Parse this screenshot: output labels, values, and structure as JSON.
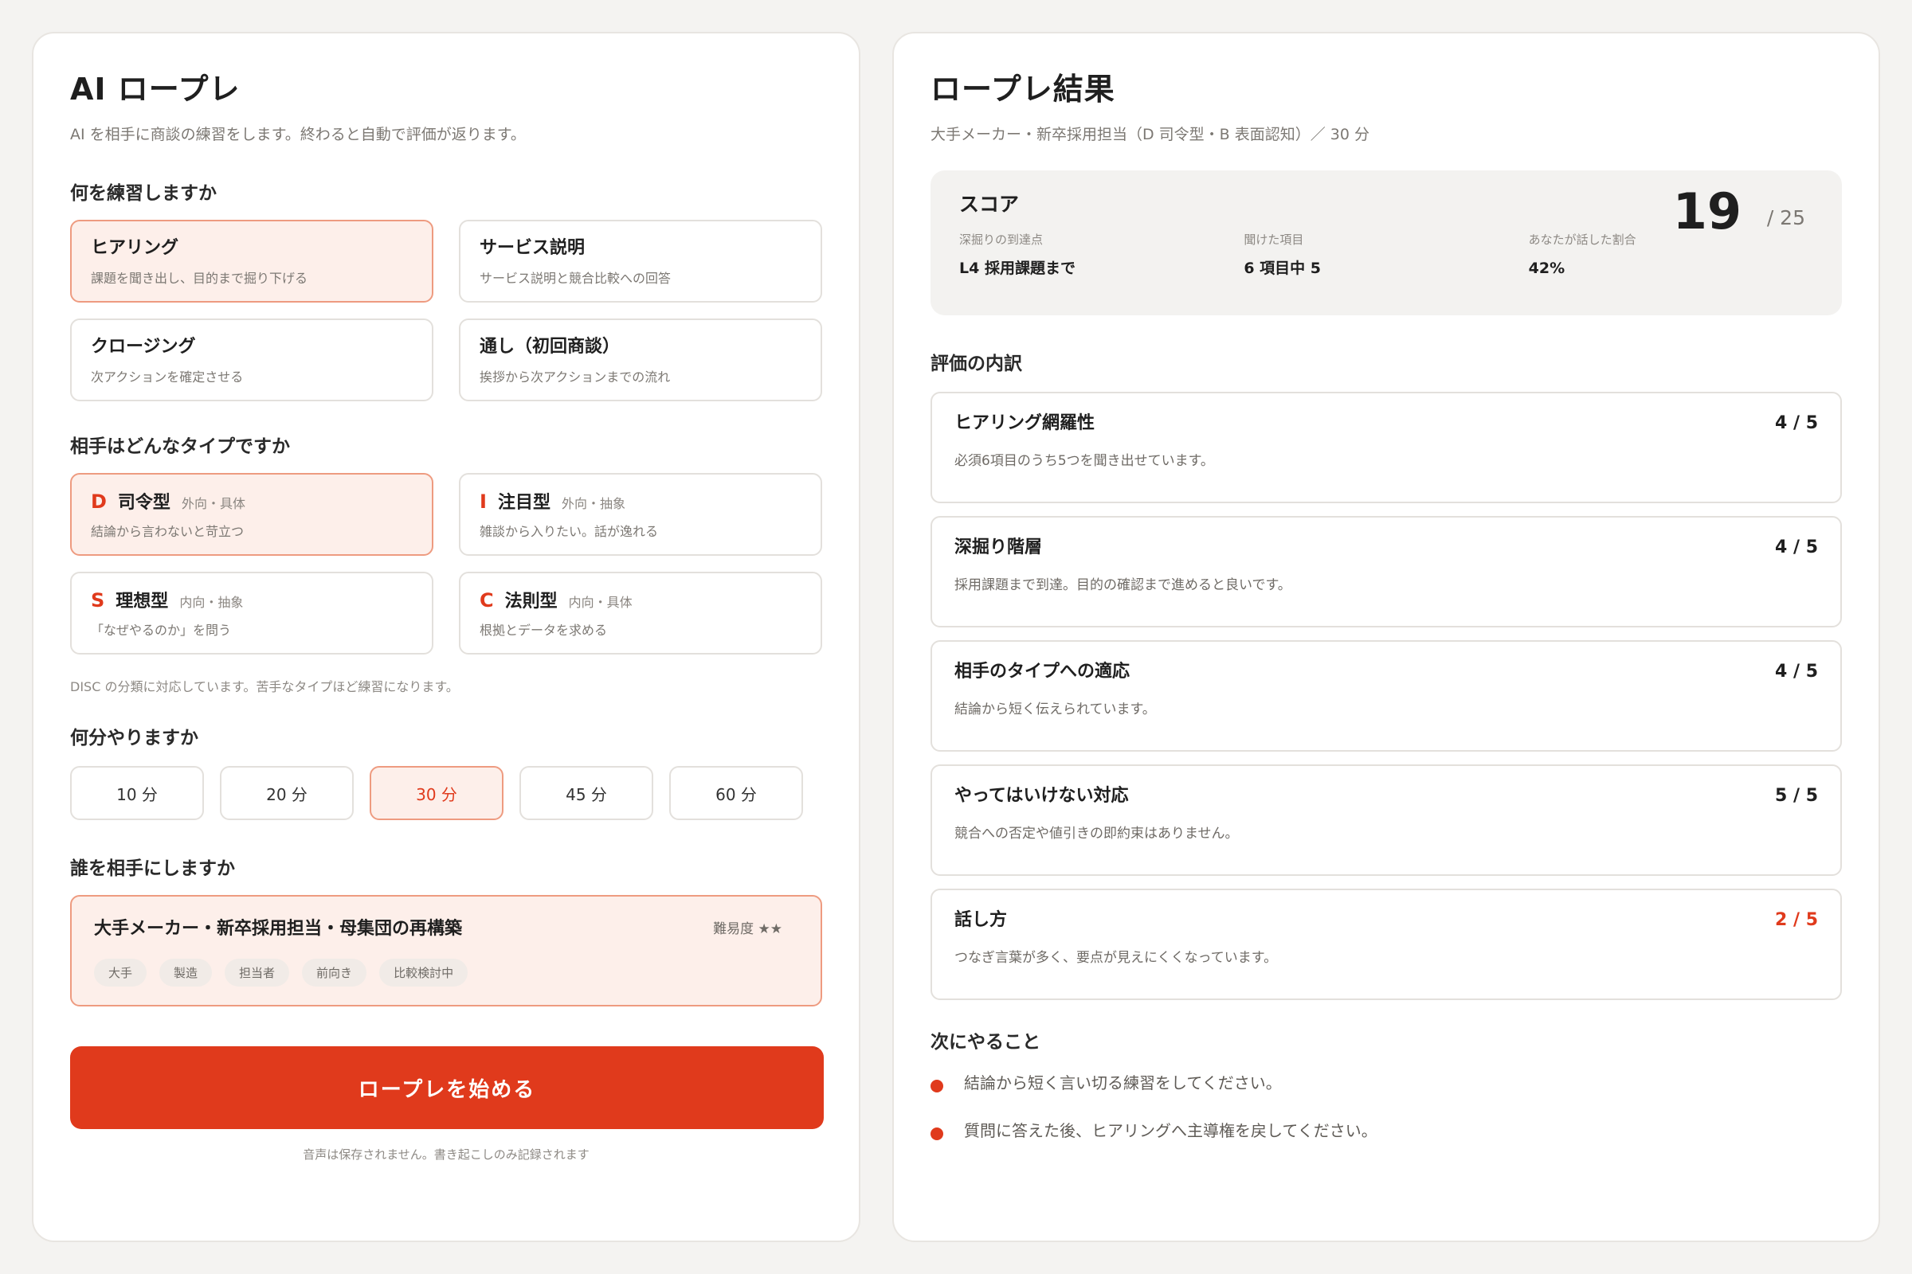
{
  "left": {
    "title": "AI ロープレ",
    "subtitle": "AI を相手に商談の練習をします。終わると自動で評価が返ります。",
    "practice": {
      "label": "何を練習しますか",
      "options": [
        {
          "title": "ヒアリング",
          "desc": "課題を聞き出し、目的まで掘り下げる",
          "selected": true
        },
        {
          "title": "サービス説明",
          "desc": "サービス説明と競合比較への回答",
          "selected": false
        },
        {
          "title": "クロージング",
          "desc": "次アクションを確定させる",
          "selected": false
        },
        {
          "title": "通し（初回商談）",
          "desc": "挨拶から次アクションまでの流れ",
          "selected": false
        }
      ]
    },
    "type": {
      "label": "相手はどんなタイプですか",
      "options": [
        {
          "letter": "D",
          "title": "司令型",
          "tag": "外向・具体",
          "desc": "結論から言わないと苛立つ",
          "selected": true
        },
        {
          "letter": "I",
          "title": "注目型",
          "tag": "外向・抽象",
          "desc": "雑談から入りたい。話が逸れる",
          "selected": false
        },
        {
          "letter": "S",
          "title": "理想型",
          "tag": "内向・抽象",
          "desc": "「なぜやるのか」を問う",
          "selected": false
        },
        {
          "letter": "C",
          "title": "法則型",
          "tag": "内向・具体",
          "desc": "根拠とデータを求める",
          "selected": false
        }
      ],
      "note": "DISC の分類に対応しています。苦手なタイプほど練習になります。"
    },
    "duration": {
      "label": "何分やりますか",
      "options": [
        "10 分",
        "20 分",
        "30 分",
        "45 分",
        "60 分"
      ],
      "selected": "30 分"
    },
    "scenario": {
      "label": "誰を相手にしますか",
      "title": "大手メーカー・新卒採用担当・母集団の再構築",
      "difficulty": "難易度 ★★",
      "tags": [
        "大手",
        "製造",
        "担当者",
        "前向き",
        "比較検討中"
      ]
    },
    "start_label": "ロープレを始める",
    "footer_note": "音声は保存されません。書き起こしのみ記録されます"
  },
  "right": {
    "title": "ロープレ結果",
    "subtitle": "大手メーカー・新卒採用担当（D 司令型・B 表面認知）／ 30 分",
    "score": {
      "label": "スコア",
      "value": "19",
      "max": "/ 25",
      "stats": [
        {
          "label": "深掘りの到達点",
          "value": "L4 採用課題まで"
        },
        {
          "label": "聞けた項目",
          "value": "6 項目中 5"
        },
        {
          "label": "あなたが話した割合",
          "value": "42%"
        }
      ]
    },
    "breakdown": {
      "label": "評価の内訳",
      "items": [
        {
          "name": "ヒアリング網羅性",
          "score": "4 / 5",
          "comment": "必須6項目のうち5つを聞き出せています。",
          "low": false
        },
        {
          "name": "深掘り階層",
          "score": "4 / 5",
          "comment": "採用課題まで到達。目的の確認まで進めると良いです。",
          "low": false
        },
        {
          "name": "相手のタイプへの適応",
          "score": "4 / 5",
          "comment": "結論から短く伝えられています。",
          "low": false
        },
        {
          "name": "やってはいけない対応",
          "score": "5 / 5",
          "comment": "競合への否定や値引きの即約束はありません。",
          "low": false
        },
        {
          "name": "話し方",
          "score": "2 / 5",
          "comment": "つなぎ言葉が多く、要点が見えにくくなっています。",
          "low": true
        }
      ]
    },
    "next": {
      "label": "次にやること",
      "items": [
        "結論から短く言い切る練習をしてください。",
        "質問に答えた後、ヒアリングへ主導権を戻してください。"
      ]
    }
  },
  "colors": {
    "accent": "#e03a1c",
    "selected_bg": "#fdefea",
    "selected_border": "#ee9b80"
  }
}
